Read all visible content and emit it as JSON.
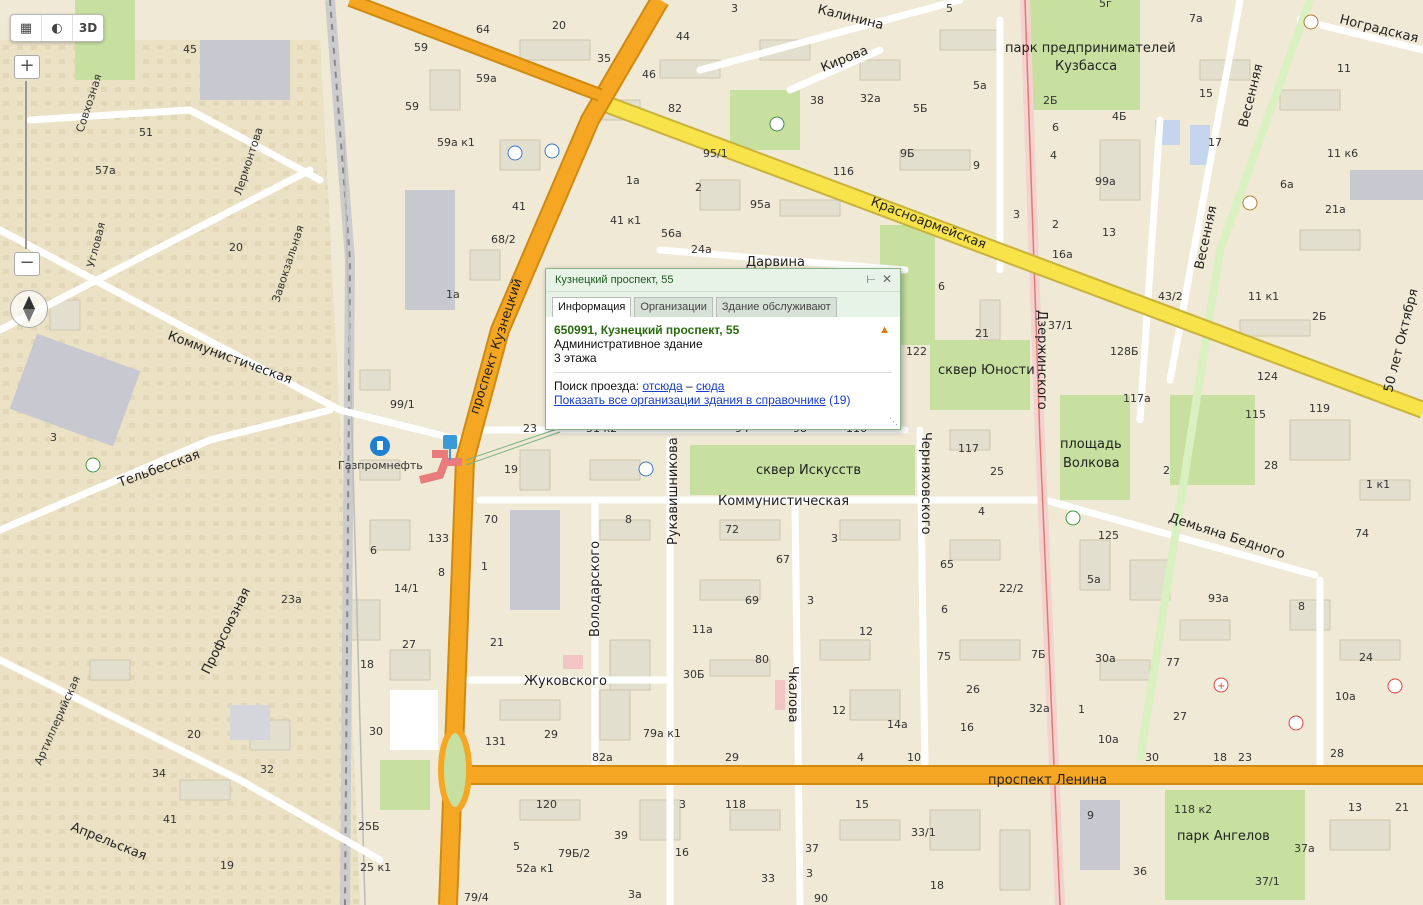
{
  "toolbar": {
    "ruler_icon": "ruler-icon",
    "traffic_icon": "traffic-icon",
    "mode_3d": "3D"
  },
  "zoom": {
    "plus": "+",
    "minus": "−"
  },
  "streets": {
    "kalinina": "Калинина",
    "kirova": "Кирова",
    "darvina": "Дарвина",
    "krasnoarmeyskaya": "Красноармейская",
    "kuznetsky": "проспект Кузнецкий",
    "kommunisticheskaya_w": "Коммунистическая",
    "kommunisticheskaya_e": "Коммунистическая",
    "telbesskaya": "Тельбесская",
    "rukavishnikova": "Рукавишникова",
    "volodarskogo": "Володарского",
    "zhukovskogo": "Жуковского",
    "chkalova": "Чкалова",
    "chernyakhovskogo": "Черняховского",
    "dzerzhinskogo": "Дзержинского",
    "lenina": "проспект Ленина",
    "demyana": "Демьяна Бедного",
    "vesennyaya1": "Весенняя",
    "vesennyaya2": "Весенняя",
    "oktyabrya": "50 лет Октября",
    "nogradskaya": "Ноградская",
    "sovkhoznaya": "Совхозная",
    "lermontova": "Лермонтова",
    "zavokzalnaya": "Завокзальная",
    "uglovaya": "Угловая",
    "profsoyuznaya": "Профсоюзная",
    "artilleriyskaya": "Артиллерийская",
    "aprelskaya": "Апрельская"
  },
  "places": {
    "park_predprinimateley": "парк предпринимателей",
    "kuzbassa": "Кузбасса",
    "skver_yunosti": "сквер Юности",
    "skver_iskusstv": "сквер Искусств",
    "ploshchad": "площадь",
    "volkova": "Волкова",
    "park_angelov": "парк Ангелов",
    "gazpromneft": "Газпромнефть"
  },
  "houses": [
    "45",
    "59",
    "64",
    "20",
    "44",
    "3",
    "5",
    "7а",
    "5г",
    "46",
    "35",
    "59а",
    "59",
    "82",
    "38",
    "32а",
    "5а",
    "5Б",
    "15",
    "4Б",
    "17",
    "11",
    "51",
    "57а",
    "59а к1",
    "95/1",
    "1а",
    "9Б",
    "9",
    "116",
    "11 к6",
    "4",
    "2Б",
    "41",
    "2",
    "95а",
    "99а",
    "6а",
    "20",
    "68/2",
    "41 к1",
    "56а",
    "3",
    "13",
    "21а",
    "11 к1",
    "24а",
    "2",
    "1а",
    "6",
    "43/2",
    "2Б",
    "21",
    "128Б",
    "99/1",
    "23",
    "51 к2",
    "94",
    "98",
    "116",
    "122",
    "124",
    "3",
    "115",
    "119",
    "117а",
    "117",
    "25",
    "2",
    "19",
    "28",
    "70",
    "8",
    "72",
    "4",
    "1 к1",
    "133",
    "3",
    "65",
    "125",
    "6",
    "1",
    "93а",
    "74",
    "5а",
    "6",
    "14/1",
    "8",
    "67",
    "69",
    "3",
    "22/2",
    "8",
    "23а",
    "21",
    "12",
    "80",
    "11а",
    "7Б",
    "24",
    "27",
    "30а",
    "77",
    "18",
    "30Б",
    "75",
    "26",
    "10а",
    "12",
    "32а",
    "10а",
    "29",
    "1",
    "27",
    "20",
    "30",
    "131",
    "79а к1",
    "82а",
    "29",
    "4",
    "10",
    "16",
    "18",
    "14а",
    "30",
    "23",
    "28",
    "32",
    "34",
    "120",
    "118",
    "3",
    "15",
    "13",
    "21",
    "39",
    "41",
    "9",
    "118 к2",
    "33/1",
    "37а",
    "25Б",
    "37",
    "79Б/2",
    "16",
    "5",
    "36",
    "3",
    "33",
    "18",
    "19",
    "25 к1",
    "52а к1",
    "79/4",
    "3а",
    "90",
    "37/1",
    "16а",
    "37/1",
    "6",
    "8",
    "3"
  ],
  "balloon": {
    "title": "Кузнецкий проспект, 55",
    "tabs": [
      "Информация",
      "Организации",
      "Здание обслуживают"
    ],
    "address": "650991, Кузнецкий проспект, 55",
    "type": "Административное здание",
    "floors": "3 этажа",
    "route_label": "Поиск проезда:",
    "from": "отсюда",
    "dash": "–",
    "to": "сюда",
    "show_all": "Показать все организации здания в справочнике",
    "count": "(19)"
  },
  "colors": {
    "background": "#efe9d5",
    "major_road": "#f5a623",
    "yellow_road": "#f8e34a",
    "park": "#c7e0a0",
    "building": "#e3dfcf",
    "industrial": "#c8c8d0",
    "link": "#1a3ec7",
    "address": "#2a6b0e"
  }
}
